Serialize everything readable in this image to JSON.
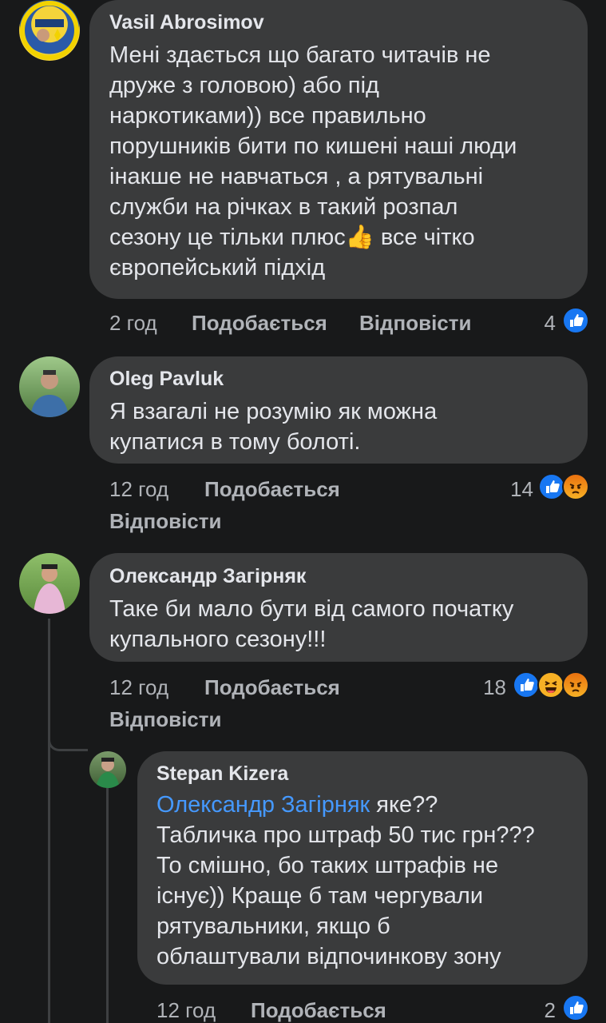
{
  "comments": [
    {
      "author": "Vasil Abrosimov",
      "text_1": "Мені здається що багато читачів не\nдруже з головою) або під\nнаркотиками)) все правильно\nпорушників бити по кишені наші люди\nінакше не навчаться , а рятувальні\nслужби на річках в такий розпал\nсезону це тільки плюс",
      "text_emoji": "👍",
      "text_2": " все чітко\nєвропейський підхід",
      "time": "2 год",
      "like_label": "Подобається",
      "reply_label": "Відповісти",
      "reaction_count": "4",
      "reactions": [
        "like-icon"
      ]
    },
    {
      "author": "Oleg Pavluk",
      "text": "Я взагалі не розумію як можна\nкупатися в тому болоті.",
      "time": "12 год",
      "like_label": "Подобається",
      "reply_label": "Відповісти",
      "reaction_count": "14",
      "reactions": [
        "like-icon",
        "angry-icon"
      ]
    },
    {
      "author": "Олександр Загірняк",
      "text": "Таке би мало бути від самого початку\nкупального сезону!!!",
      "time": "12 год",
      "like_label": "Подобається",
      "reply_label": "Відповісти",
      "reaction_count": "18",
      "reactions": [
        "like-icon",
        "haha-icon",
        "angry-icon"
      ]
    }
  ],
  "reply": {
    "author": "Stepan Kizera",
    "mention": "Олександр Загірняк",
    "text": " яке??\nТабличка про штраф 50 тис грн???\nТо смішно, бо таких штрафів не\nіснує)) Краще б там чергували\nрятувальники, якщо б\nоблаштували відпочинкову зону",
    "time": "12 год",
    "like_label": "Подобається",
    "reaction_count": "2",
    "reactions": [
      "like-icon"
    ]
  },
  "colors": {
    "background": "#18191a",
    "bubble": "#3a3b3c",
    "text": "#e4e6eb",
    "meta": "#b0b3b8",
    "mention": "#4599ff",
    "like": "#1877f2"
  }
}
